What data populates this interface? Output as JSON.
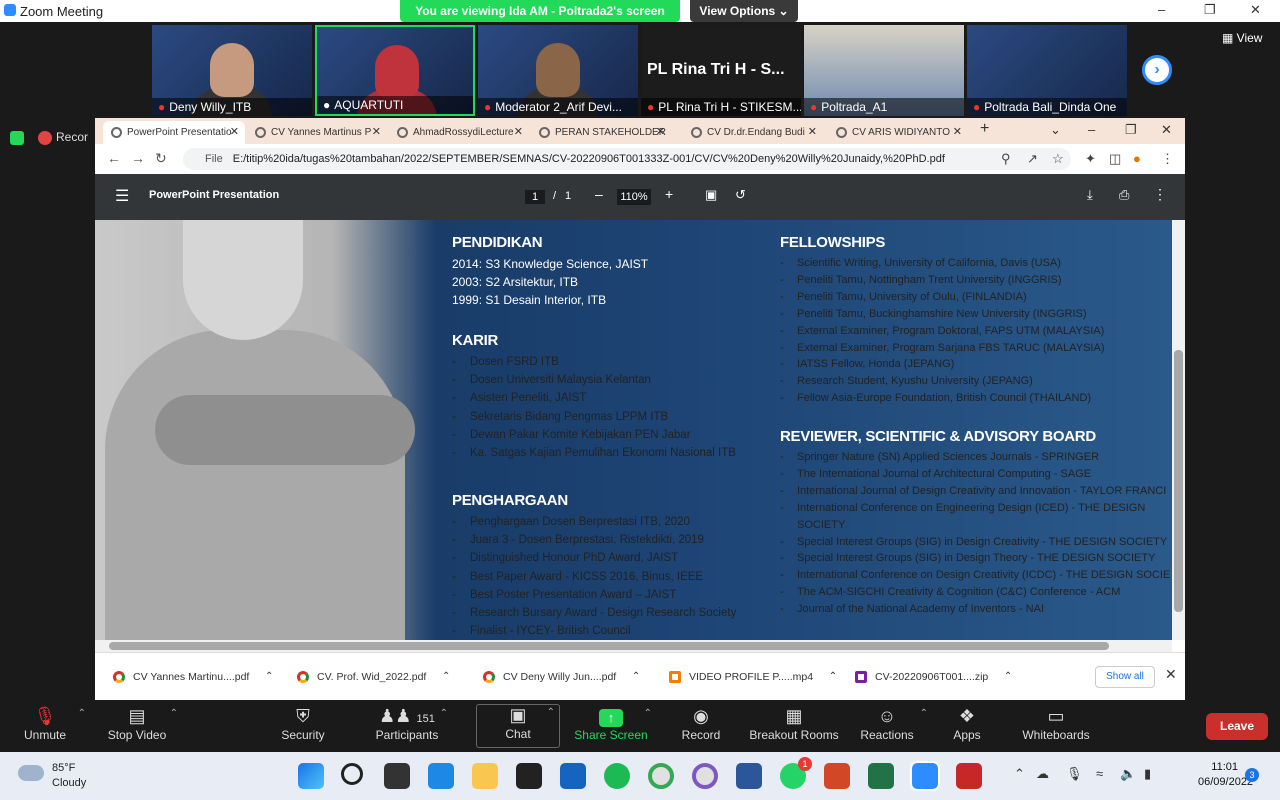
{
  "window": {
    "title": "Zoom Meeting"
  },
  "banner": {
    "viewing": "You are viewing Ida AM - Poltrada2's screen",
    "view_options": "View Options"
  },
  "gallery": {
    "tiles": [
      {
        "name": "Deny Willy_ITB"
      },
      {
        "name": "AQUARTUTI"
      },
      {
        "name": "Moderator 2_Arif Devi..."
      },
      {
        "name": "PL Rina Tri H - STIKESM...",
        "big": "PL Rina Tri H - S..."
      },
      {
        "name": "Poltrada_A1"
      },
      {
        "name": "Poltrada Bali_Dinda One"
      }
    ],
    "view_label": "View"
  },
  "recording": {
    "label": "Recor"
  },
  "browser": {
    "tabs": [
      {
        "label": "PowerPoint Presentatio"
      },
      {
        "label": "CV Yannes Martinus P"
      },
      {
        "label": "AhmadRossydiLecture"
      },
      {
        "label": "PERAN STAKEHOLDER"
      },
      {
        "label": "CV Dr.dr.Endang Budi"
      },
      {
        "label": "CV ARIS WIDIYANTO"
      }
    ],
    "address_scheme": "File",
    "address": "E:/titip%20ida/tugas%20tambahan/2022/SEPTEMBER/SEMNAS/CV-20220906T001333Z-001/CV/CV%20Deny%20Willy%20Junaidy,%20PhD.pdf"
  },
  "pdf": {
    "title": "PowerPoint Presentation",
    "page_current": "1",
    "page_sep": "/",
    "page_total": "1",
    "zoom": "110%"
  },
  "slide": {
    "pendidikan": {
      "heading": "PENDIDIKAN",
      "rows": [
        "2014:  S3  Knowledge Science, JAIST",
        "2003:  S2  Arsitektur, ITB",
        "1999:  S1  Desain Interior, ITB"
      ]
    },
    "karir": {
      "heading": "KARIR",
      "items": [
        "Dosen FSRD ITB",
        "Dosen Universiti Malaysia Kelantan",
        "Asisten Peneliti, JAIST",
        "Sekretaris Bidang Pengmas LPPM ITB",
        "Dewan Pakar Komite Kebijakan PEN Jabar",
        "Ka. Satgas Kajian Pemulihan Ekonomi Nasional ITB"
      ]
    },
    "penghargaan": {
      "heading": "PENGHARGAAN",
      "items": [
        "Penghargaan Dosen Berprestasi ITB, 2020",
        "Juara 3 - Dosen Berprestasi, Ristekdikti, 2019",
        "Distinguished Honour PhD Award, JAIST",
        "Best Paper Award - KICSS 2016, Binus, IEEE",
        "Best Poster Presentation Award – JAIST",
        "Research Bursary Award - Design Research Society",
        "Finalist - IYCEY- British Council"
      ]
    },
    "fellowships": {
      "heading": "FELLOWSHIPS",
      "items": [
        "Scientific Writing, University of California, Davis (USA)",
        "Peneliti Tamu, Nottingham Trent University (INGGRIS)",
        "Peneliti Tamu, University of Oulu, (FINLANDIA)",
        "Peneliti Tamu, Buckinghamshire New University (INGGRIS)",
        "External Examiner, Program Doktoral, FAPS UTM (MALAYSIA)",
        "External Examiner, Program Sarjana FBS TARUC (MALAYSIA)",
        "IATSS Fellow, Honda (JEPANG)",
        "Research Student, Kyushu University (JEPANG)",
        "Fellow Asia-Europe Foundation, British Council (THAILAND)"
      ]
    },
    "reviewer": {
      "heading": "REVIEWER, SCIENTIFIC & ADVISORY BOARD",
      "items": [
        "Springer Nature (SN) Applied Sciences Journals - SPRINGER",
        "The International Journal of Architectural Computing  - SAGE",
        "International Journal of Design Creativity and Innovation - TAYLOR FRANCI",
        "International Conference on Engineering Design (ICED) - THE DESIGN",
        "SOCIETY",
        "Special Interest Groups (SIG) in Design Creativity - THE DESIGN SOCIETY",
        "Special Interest Groups (SIG) in Design Theory - THE DESIGN SOCIETY",
        "International Conference on Design Creativity (ICDC) - THE DESIGN SOCIE",
        "The ACM-SIGCHI Creativity & Cognition (C&C) Conference - ACM",
        "Journal of the National Academy of Inventors - NAI"
      ]
    }
  },
  "downloads": {
    "items": [
      {
        "label": "CV Yannes Martinu....pdf"
      },
      {
        "label": "CV. Prof. Wid_2022.pdf"
      },
      {
        "label": "CV Deny Willy Jun....pdf"
      },
      {
        "label": "VIDEO PROFILE P.....mp4"
      },
      {
        "label": "CV-20220906T001....zip"
      }
    ],
    "show_all": "Show all"
  },
  "toolbar": {
    "unmute": "Unmute",
    "stop_video": "Stop Video",
    "security": "Security",
    "participants": "Participants",
    "participants_count": "151",
    "chat": "Chat",
    "share_screen": "Share Screen",
    "record": "Record",
    "breakout": "Breakout Rooms",
    "reactions": "Reactions",
    "apps": "Apps",
    "whiteboards": "Whiteboards",
    "leave": "Leave"
  },
  "taskbar": {
    "temp": "85°F",
    "weather": "Cloudy",
    "time": "11:01",
    "date": "06/09/2022",
    "notifications": "3",
    "whatsapp_badge": "1"
  },
  "colors": {
    "zoom_green": "#23d959",
    "zoom_blue": "#2D8CFF",
    "leave_red": "#c9302c"
  }
}
